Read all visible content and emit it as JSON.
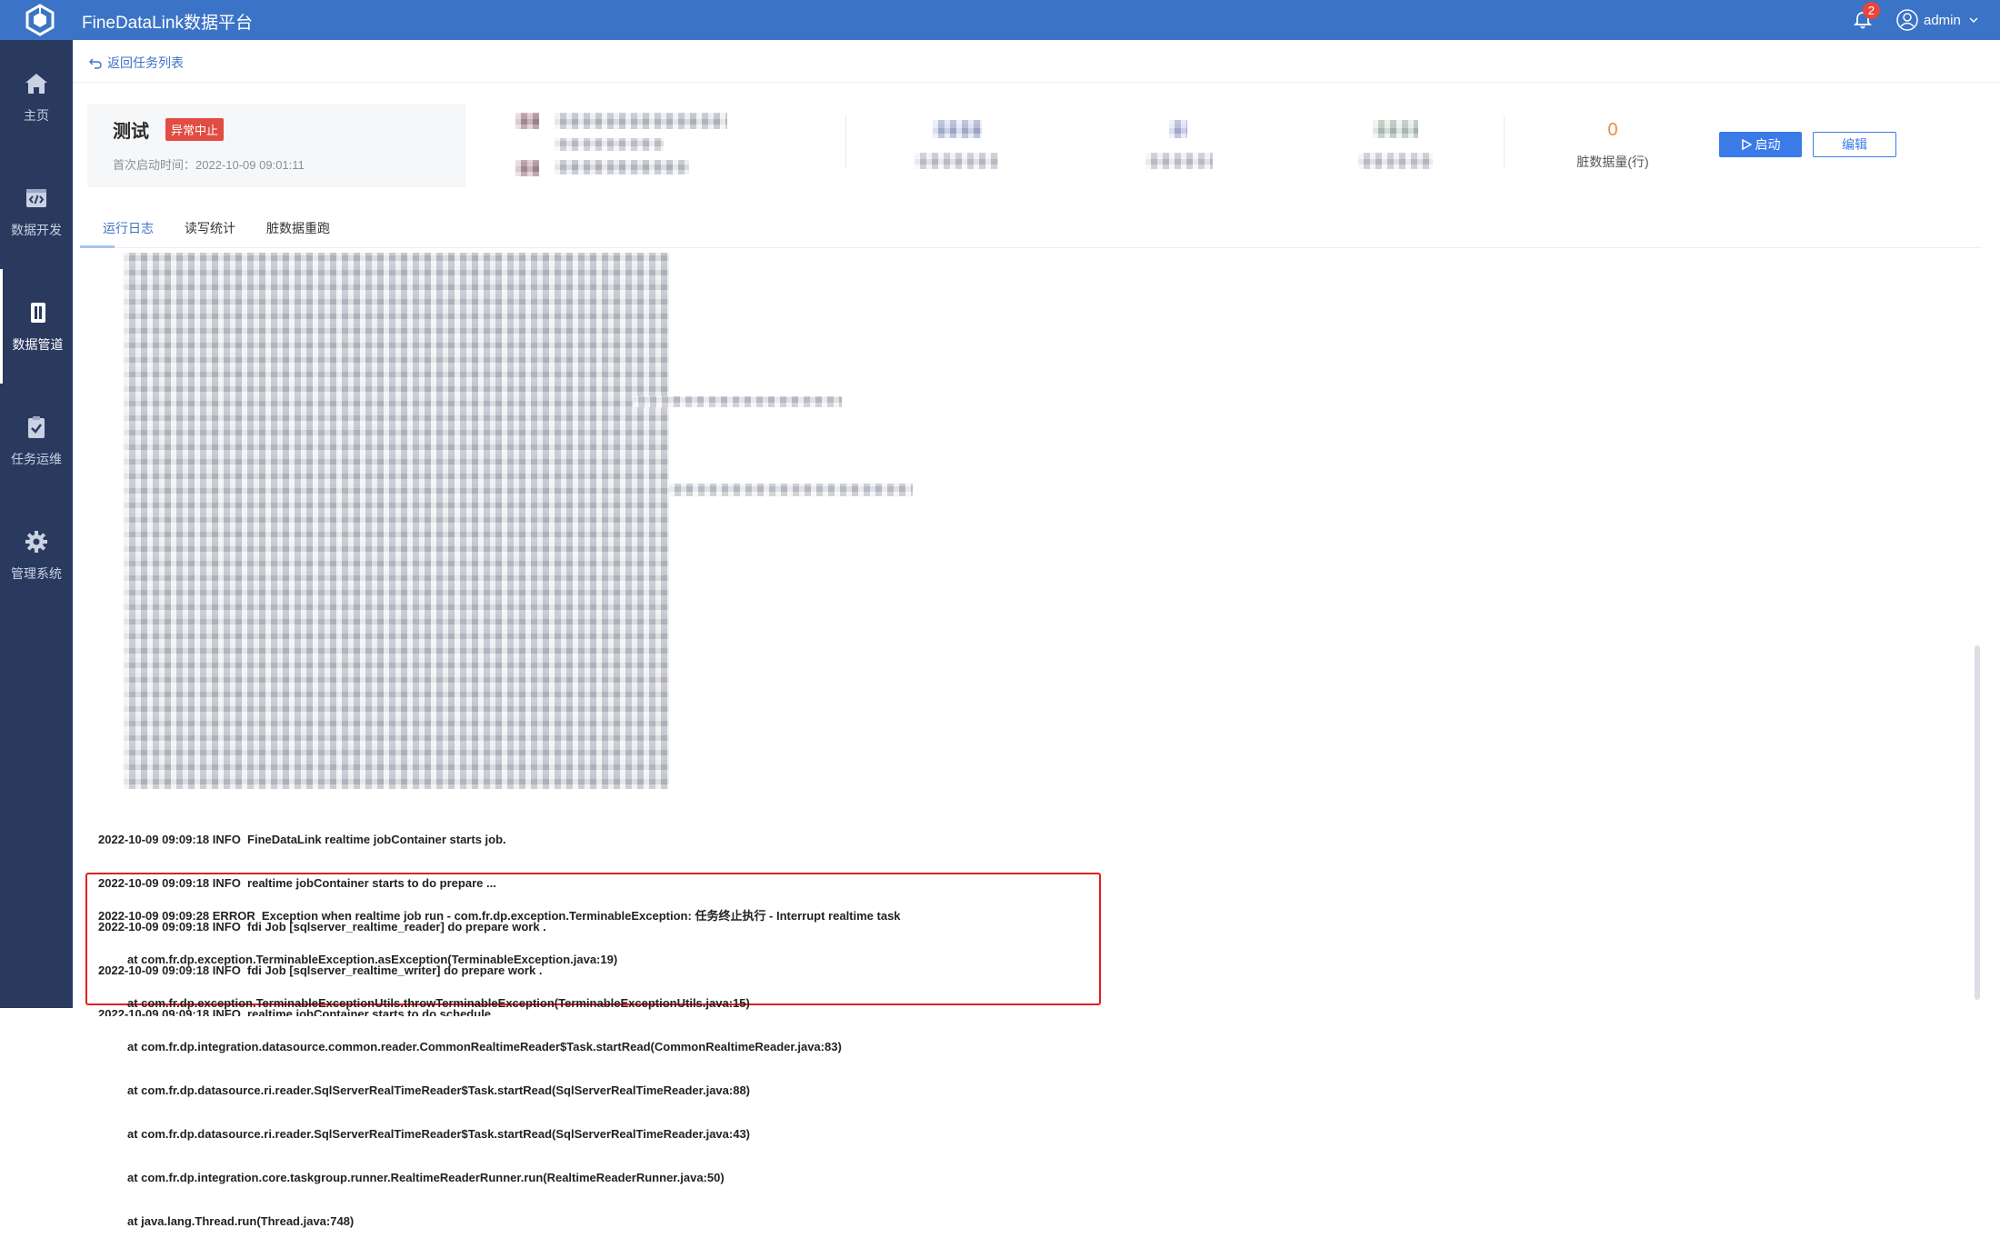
{
  "app": {
    "title": "FineDataLink数据平台",
    "notification_count": "2",
    "user": "admin"
  },
  "sidebar": {
    "items": [
      {
        "label": "主页",
        "icon": "home-icon"
      },
      {
        "label": "数据开发",
        "icon": "code-window-icon"
      },
      {
        "label": "数据管道",
        "icon": "pipeline-icon"
      },
      {
        "label": "任务运维",
        "icon": "clipboard-check-icon"
      },
      {
        "label": "管理系统",
        "icon": "gear-icon"
      }
    ],
    "active_index": 2
  },
  "breadcrumb": {
    "back_label": "返回任务列表"
  },
  "task": {
    "name": "测试",
    "status": "异常中止",
    "start_time_label": "首次启动时间：",
    "start_time": "2022-10-09 09:01:11"
  },
  "stats": {
    "dirty_count": "0",
    "dirty_label": "脏数据量(行)"
  },
  "buttons": {
    "start": "启动",
    "edit": "编辑"
  },
  "tabs": [
    "运行日志",
    "读写统计",
    "脏数据重跑"
  ],
  "log": {
    "lines": [
      "2022-10-09 09:09:18 INFO  FineDataLink realtime jobContainer starts job.",
      "2022-10-09 09:09:18 INFO  realtime jobContainer starts to do prepare ...",
      "2022-10-09 09:09:18 INFO  fdi Job [sqlserver_realtime_reader] do prepare work .",
      "2022-10-09 09:09:18 INFO  fdi Job [sqlserver_realtime_writer] do prepare work .",
      "2022-10-09 09:09:18 INFO  realtime jobContainer starts to do schedule ..."
    ],
    "error_header": "2022-10-09 09:09:28 ERROR  Exception when realtime job run - com.fr.dp.exception.TerminableException: 任务终止执行 - Interrupt realtime task",
    "error_trace": [
      "at com.fr.dp.exception.TerminableException.asException(TerminableException.java:19)",
      "at com.fr.dp.exception.TerminableExceptionUtils.throwTerminableException(TerminableExceptionUtils.java:15)",
      "at com.fr.dp.integration.datasource.common.reader.CommonRealtimeReader$Task.startRead(CommonRealtimeReader.java:83)",
      "at com.fr.dp.datasource.ri.reader.SqlServerRealTimeReader$Task.startRead(SqlServerRealTimeReader.java:88)",
      "at com.fr.dp.datasource.ri.reader.SqlServerRealTimeReader$Task.startRead(SqlServerRealTimeReader.java:43)",
      "at com.fr.dp.integration.core.taskgroup.runner.RealtimeReaderRunner.run(RealtimeReaderRunner.java:50)",
      "at java.lang.Thread.run(Thread.java:748)"
    ]
  },
  "colors": {
    "topbar": "#3b73c6",
    "sidebar": "#2a3a5f",
    "error": "#e0201c",
    "status_badge": "#e24c42",
    "dirty_count": "#f08a3c"
  }
}
